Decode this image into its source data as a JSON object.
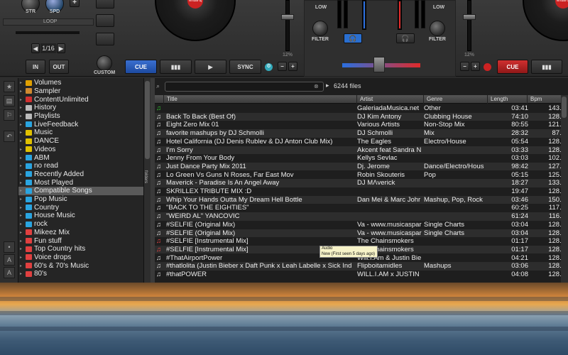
{
  "left_deck": {
    "knob1_label": "STR",
    "knob2_label": "SPD",
    "loop_label": "LOOP",
    "loop_size": "1/16",
    "in_label": "IN",
    "out_label": "OUT",
    "custom_label": "CUSTOM",
    "cue_label": "CUE",
    "sync_label": "SYNC",
    "pitch_value": "12%"
  },
  "mixer": {
    "low_left": "LOW",
    "low_right": "LOW",
    "filter_left": "FILTER",
    "filter_right": "FILTER"
  },
  "right_deck": {
    "pitch_value": "12%",
    "cue_label": "CUE"
  },
  "sidebar": {
    "items": [
      {
        "label": "Volumes",
        "icon": "folder-icon",
        "color": "#e0a000"
      },
      {
        "label": "Sampler",
        "icon": "sampler-icon",
        "color": "#d08a30"
      },
      {
        "label": "ContentUnlimited",
        "icon": "cloud-icon",
        "color": "#d03030"
      },
      {
        "label": "History",
        "icon": "history-icon",
        "color": "#bbbbbb"
      },
      {
        "label": "Playlists",
        "icon": "playlist-icon",
        "color": "#bbbbbb"
      },
      {
        "label": "LiveFeedback",
        "icon": "feedback-icon",
        "color": "#2aa4e0"
      },
      {
        "label": "Music",
        "icon": "star-folder-icon",
        "color": "#e0c000"
      },
      {
        "label": "DANCE",
        "icon": "star-folder-icon",
        "color": "#e0c000"
      },
      {
        "label": "Videos",
        "icon": "star-folder-icon",
        "color": "#e0c000"
      },
      {
        "label": "ABM",
        "icon": "filter-folder-icon",
        "color": "#2aa4e0"
      },
      {
        "label": "no read",
        "icon": "filter-folder-icon",
        "color": "#2aa4e0"
      },
      {
        "label": "Recently Added",
        "icon": "filter-folder-icon",
        "color": "#2aa4e0"
      },
      {
        "label": "Most Played",
        "icon": "filter-folder-icon",
        "color": "#2aa4e0"
      },
      {
        "label": "Compatible Songs",
        "icon": "filter-folder-icon",
        "color": "#2aa4e0"
      },
      {
        "label": "Pop Music",
        "icon": "filter-folder-icon",
        "color": "#2aa4e0"
      },
      {
        "label": "Country",
        "icon": "filter-folder-icon",
        "color": "#2aa4e0"
      },
      {
        "label": "House Music",
        "icon": "filter-folder-icon",
        "color": "#2aa4e0"
      },
      {
        "label": "rock",
        "icon": "filter-folder-icon",
        "color": "#2aa4e0"
      },
      {
        "label": "Mikeez Mix",
        "icon": "playlist-folder-icon",
        "color": "#e04040"
      },
      {
        "label": "Fun stuff",
        "icon": "playlist-folder-icon",
        "color": "#e04040"
      },
      {
        "label": "Top Country hits",
        "icon": "playlist-folder-icon",
        "color": "#e04040"
      },
      {
        "label": "Voice drops",
        "icon": "playlist-folder-icon",
        "color": "#e04040"
      },
      {
        "label": "60's & 70's Music",
        "icon": "playlist-folder-icon",
        "color": "#e04040"
      },
      {
        "label": "80's",
        "icon": "playlist-folder-icon",
        "color": "#e04040"
      }
    ],
    "selected_index": 13
  },
  "browser": {
    "search_value": "",
    "file_count": "6244 files",
    "columns": [
      "Title",
      "Artist",
      "Genre",
      "Length",
      "Bpm"
    ],
    "rows": [
      {
        "title": "",
        "artist": "GaleriadaMusica.net",
        "genre": "Other",
        "length": "03:41",
        "bpm": "143.0",
        "icon": "audio-green"
      },
      {
        "title": "Back To Back  (Best Of)",
        "artist": "DJ Kim Antony",
        "genre": "Clubbing House",
        "length": "74:10",
        "bpm": "128.0",
        "icon": "audio"
      },
      {
        "title": "Eight Zero Mix 01",
        "artist": "Various Artists",
        "genre": "Non-Stop Mix",
        "length": "80:55",
        "bpm": "121.2",
        "icon": "audio"
      },
      {
        "title": "favorite mashups by DJ Schmolli",
        "artist": "DJ Schmolli",
        "genre": "Mix",
        "length": "28:32",
        "bpm": "87.0",
        "icon": "audio"
      },
      {
        "title": "Hotel California (DJ Denis Rublev & DJ Anton Club Mix)",
        "artist": "The Eagles",
        "genre": "Electro/House",
        "length": "05:54",
        "bpm": "128.0",
        "icon": "audio"
      },
      {
        "title": "I'm Sorry",
        "artist": "Akcent  feat Sandra N",
        "genre": "",
        "length": "03:33",
        "bpm": "128.0",
        "icon": "audio"
      },
      {
        "title": "Jenny From Your Body",
        "artist": "Kellys Sevlac",
        "genre": "",
        "length": "03:03",
        "bpm": "102.0",
        "icon": "audio"
      },
      {
        "title": "Just Dance Party Mix 2011",
        "artist": "Dj. Jerome",
        "genre": "Dance/Electro/Hous",
        "length": "98:42",
        "bpm": "127.1",
        "icon": "audio"
      },
      {
        "title": "Lo Green Vs Guns N Roses, Far East Mov",
        "artist": "Robin Skouteris",
        "genre": "Pop",
        "length": "05:15",
        "bpm": "125.0",
        "icon": "audio"
      },
      {
        "title": "Maverick - Paradise Is An Angel Away",
        "artist": "DJ MΛverick",
        "genre": "",
        "length": "18:27",
        "bpm": "133.0",
        "icon": "audio"
      },
      {
        "title": "SKRILLEX TRIBUTE MIX :D",
        "artist": "",
        "genre": "",
        "length": "19:47",
        "bpm": "128.7",
        "icon": "audio"
      },
      {
        "title": "Whip Your Hands Outta My Dream Hell Bottle",
        "artist": "Dan Mei & Marc Johr",
        "genre": "Mashup, Pop, Rock",
        "length": "03:46",
        "bpm": "150.0",
        "icon": "audio"
      },
      {
        "title": "\"BACK TO THE EIGHTIES\"",
        "artist": "",
        "genre": "",
        "length": "60:25",
        "bpm": "117.0",
        "icon": "audio"
      },
      {
        "title": "\"WEIRD AL\" YANCOVIC",
        "artist": "",
        "genre": "",
        "length": "61:24",
        "bpm": "116.5",
        "icon": "audio"
      },
      {
        "title": "#SELFIE (Original Mix)",
        "artist": "Va - www.musicaspar",
        "genre": "Single Charts",
        "length": "03:04",
        "bpm": "128.0",
        "icon": "audio"
      },
      {
        "title": "#SELFIE (Original Mix)",
        "artist": "Va - www.musicaspar",
        "genre": "Single Charts",
        "length": "03:04",
        "bpm": "128.0",
        "icon": "audio"
      },
      {
        "title": "#SELFIE [Instrumental Mix]",
        "artist": "The Chainsmokers",
        "genre": "",
        "length": "01:17",
        "bpm": "128.0",
        "icon": "audio-red"
      },
      {
        "title": "#SELFIE [Instrumental Mix]",
        "artist": "The Chainsmokers",
        "genre": "",
        "length": "01:17",
        "bpm": "128.0",
        "icon": "audio-red"
      },
      {
        "title": "#ThatAirportPower",
        "artist": "Will.I.Am & Justin Bie",
        "genre": "",
        "length": "04:21",
        "bpm": "128.0",
        "icon": "audio"
      },
      {
        "title": "#thatlolita (Justin Bieber x Daft Punk x Leah Labelle x Sick Ind",
        "artist": "Flipboitamidles",
        "genre": "Mashups",
        "length": "03:06",
        "bpm": "128.0",
        "icon": "audio"
      },
      {
        "title": "#thatPOWER",
        "artist": "WILL.I.AM x JUSTIN",
        "genre": "",
        "length": "04:08",
        "bpm": "128.0",
        "icon": "audio"
      }
    ]
  },
  "tooltip": {
    "line1": "Audio",
    "line2": "New (First seen 5 days ago)"
  },
  "folders_tab": "folders"
}
